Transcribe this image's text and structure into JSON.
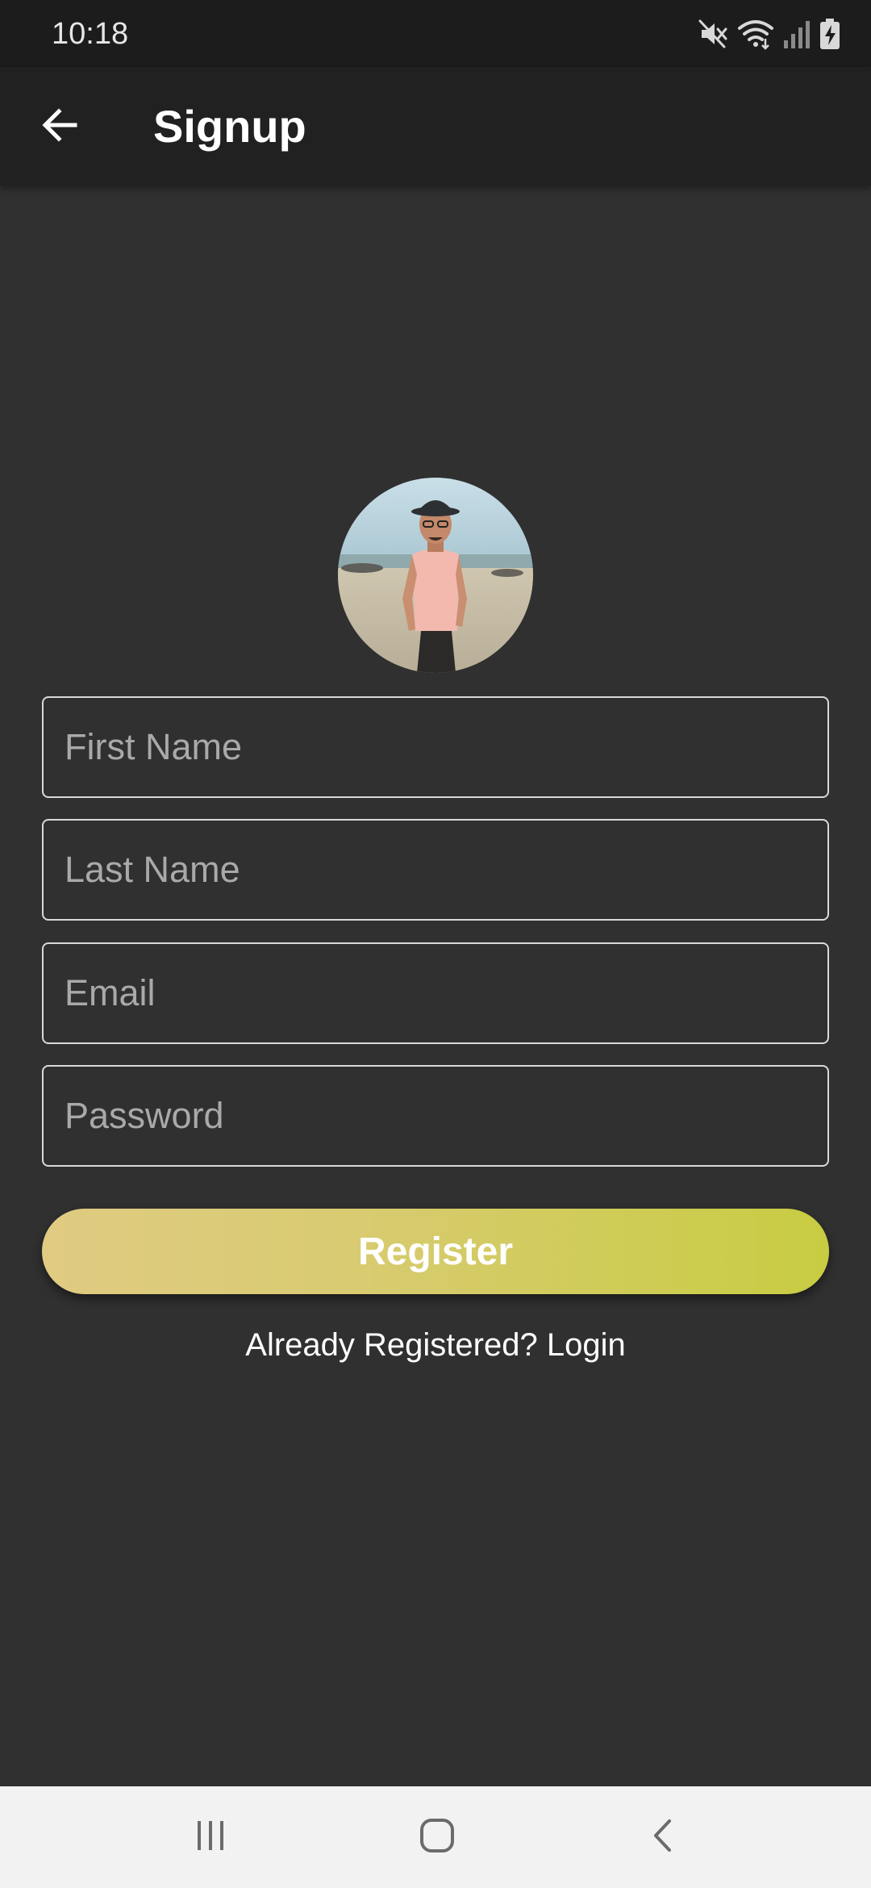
{
  "status_bar": {
    "time": "10:18",
    "icons": [
      "mute-icon",
      "wifi-icon",
      "signal-icon",
      "battery-charging-icon"
    ]
  },
  "app_bar": {
    "back_icon": "arrow-left-icon",
    "title": "Signup"
  },
  "avatar": {
    "alt": "Profile photo"
  },
  "form": {
    "first_name": {
      "placeholder": "First Name",
      "value": ""
    },
    "last_name": {
      "placeholder": "Last Name",
      "value": ""
    },
    "email": {
      "placeholder": "Email",
      "value": ""
    },
    "password": {
      "placeholder": "Password",
      "value": ""
    }
  },
  "register_button": {
    "label": "Register",
    "gradient": [
      "#e0cb82",
      "#c8cc42"
    ]
  },
  "login_link": {
    "label": "Already Registered? Login"
  },
  "nav_bar": {
    "icons": [
      "recent-apps-icon",
      "home-icon",
      "back-icon"
    ]
  },
  "colors": {
    "background": "#303030",
    "app_bar": "#212121",
    "status_bar": "#1c1c1c",
    "nav_bar": "#f2f2f2"
  }
}
